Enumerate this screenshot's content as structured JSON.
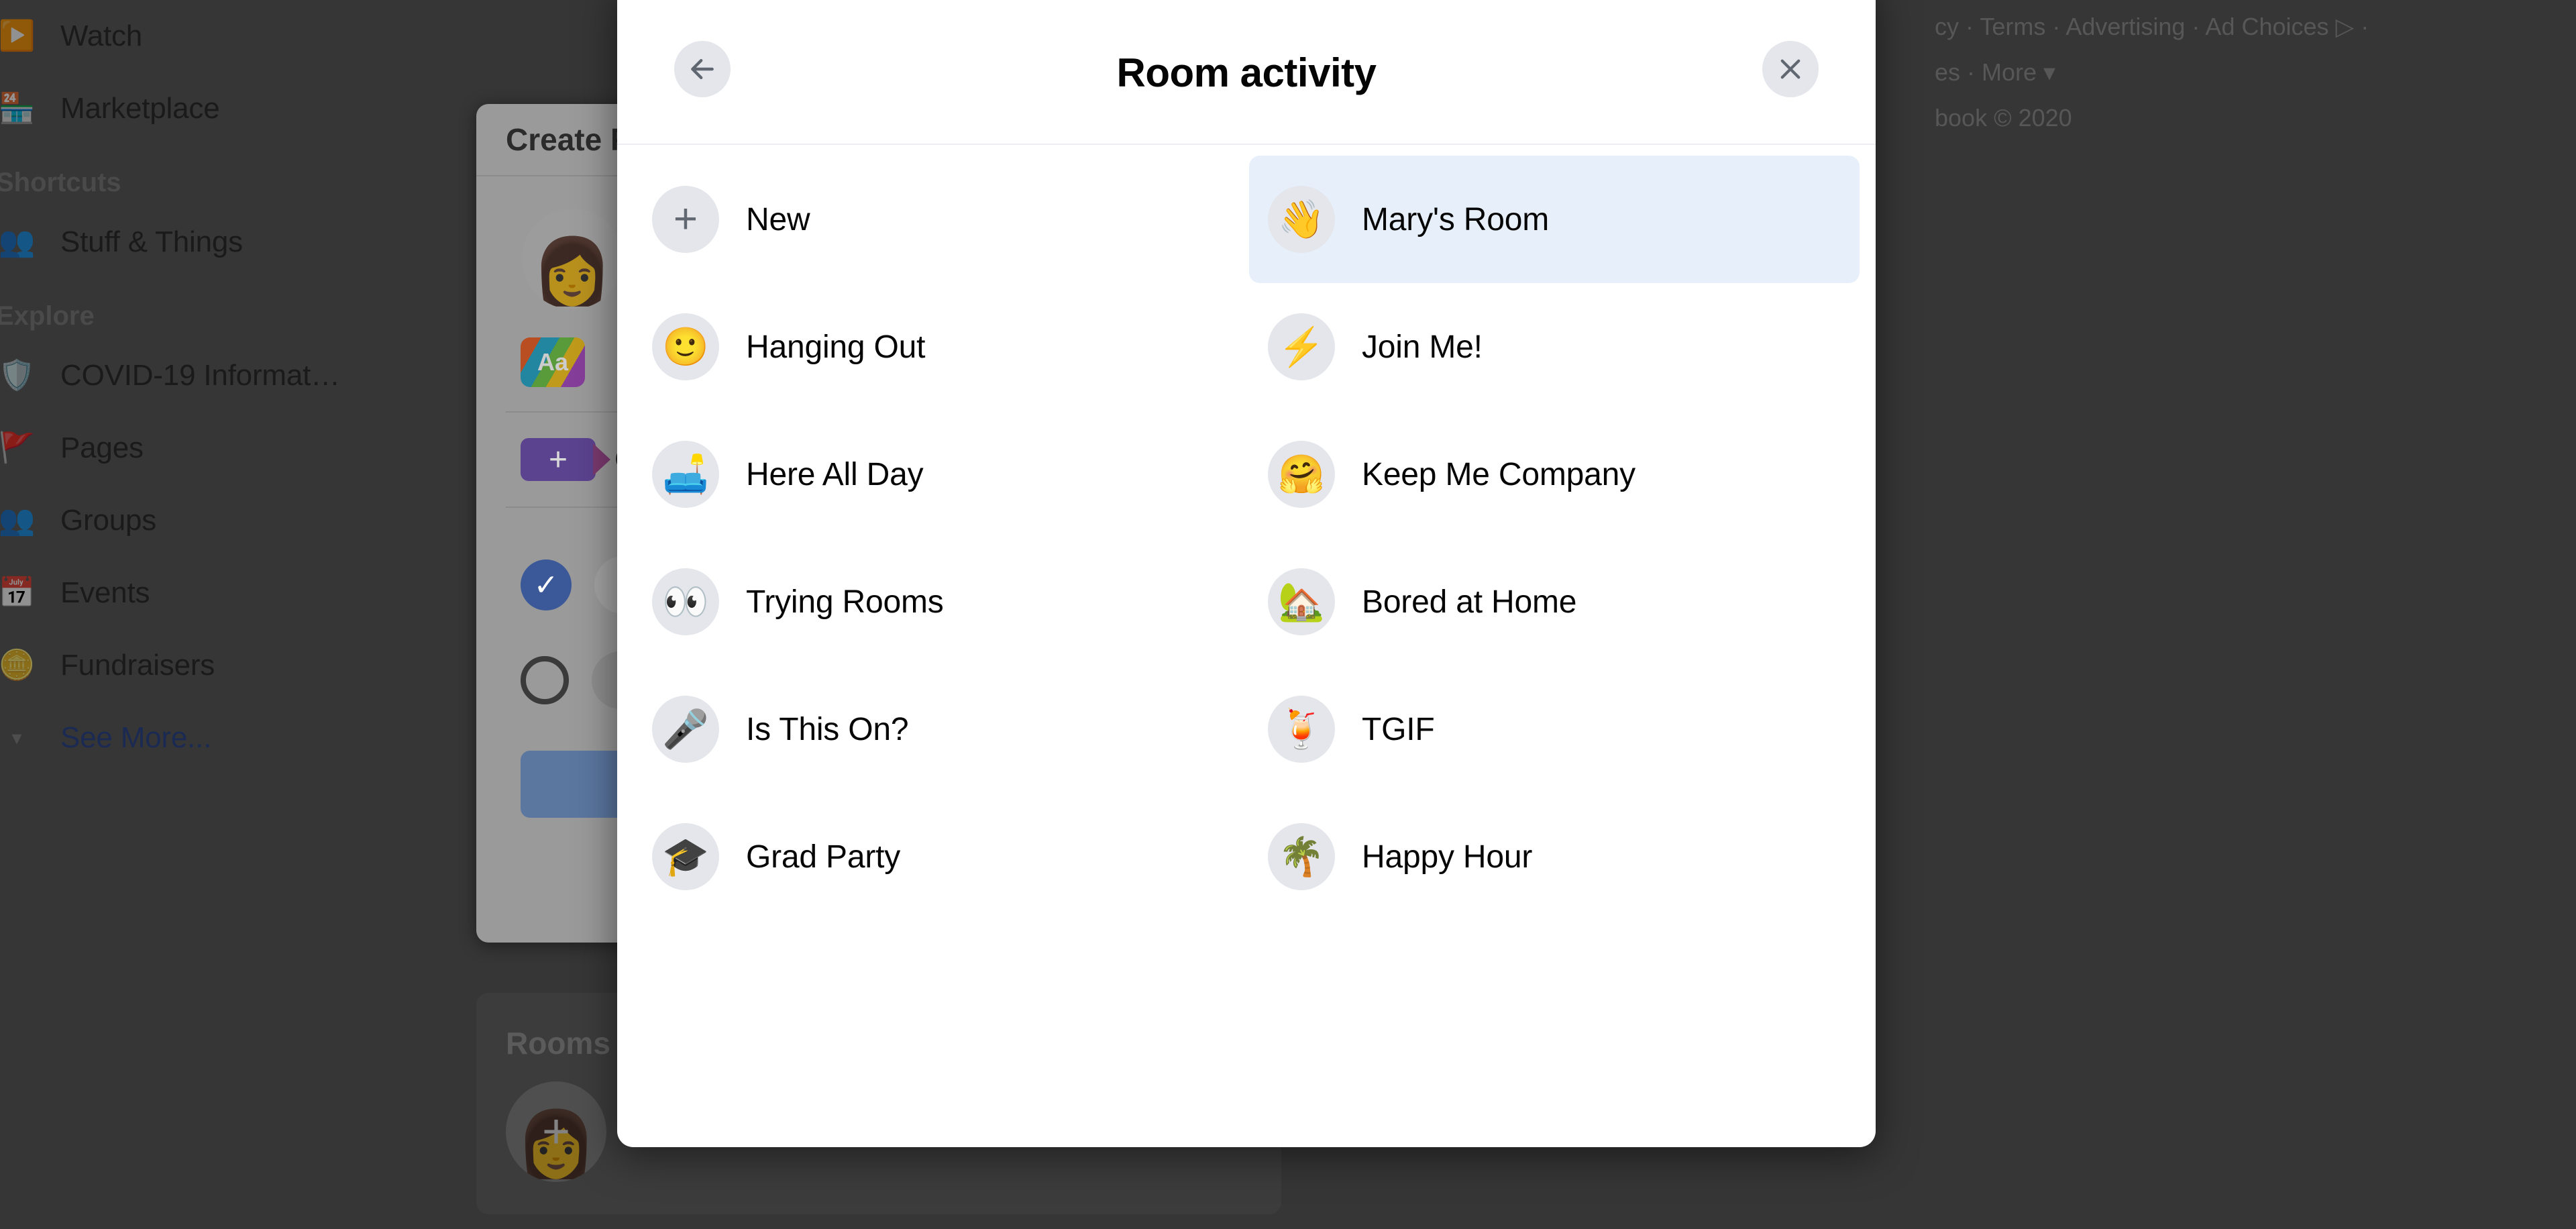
{
  "sidebar": {
    "items": [
      {
        "label": "Watch",
        "icon": "watch-icon",
        "glyph": "▶️"
      },
      {
        "label": "Marketplace",
        "icon": "marketplace-icon",
        "glyph": "🏪"
      }
    ],
    "shortcuts_heading": "Shortcuts",
    "shortcuts": [
      {
        "label": "Stuff & Things",
        "icon": "group-icon",
        "glyph": "👥"
      }
    ],
    "explore_heading": "Explore",
    "explore": [
      {
        "label": "COVID-19 Informat…",
        "icon": "covid-shield-icon",
        "glyph": "🛡️"
      },
      {
        "label": "Pages",
        "icon": "pages-flag-icon",
        "glyph": "🚩"
      },
      {
        "label": "Groups",
        "icon": "groups-icon",
        "glyph": "👥"
      },
      {
        "label": "Events",
        "icon": "events-calendar-icon",
        "glyph": "📅"
      },
      {
        "label": "Fundraisers",
        "icon": "fundraisers-icon",
        "glyph": "🪙"
      }
    ],
    "see_more": "See More..."
  },
  "create_post": {
    "title": "Create P",
    "text_bg_label": "Aa",
    "video_row_label": "C",
    "avatar": "👩"
  },
  "rooms_card": {
    "title": "Rooms",
    "avatar": "👩",
    "plus": "+"
  },
  "footer": {
    "line1": "cy · Terms · Advertising · Ad Choices ▷ ·",
    "line2": "es · More ▾",
    "line3": "book © 2020"
  },
  "modal": {
    "title": "Room activity",
    "back_icon": "arrow-left-icon",
    "close_icon": "close-icon",
    "selected_index": 1,
    "highlight_color": "#e7f0fa",
    "items": [
      {
        "label": "New",
        "icon": "plus-icon",
        "glyph": "+",
        "selected": false
      },
      {
        "label": "Mary's Room",
        "icon": "waving-hand-icon",
        "glyph": "👋",
        "selected": true
      },
      {
        "label": "Hanging Out",
        "icon": "smiley-face-icon",
        "glyph": "🙂",
        "selected": false
      },
      {
        "label": "Join Me!",
        "icon": "lightning-bolt-icon",
        "glyph": "⚡",
        "selected": false
      },
      {
        "label": "Here All Day",
        "icon": "couch-lamp-icon",
        "glyph": "🛋️",
        "selected": false
      },
      {
        "label": "Keep Me Company",
        "icon": "smiling-hands-icon",
        "glyph": "🤗",
        "selected": false
      },
      {
        "label": "Trying Rooms",
        "icon": "eyes-icon",
        "glyph": "👀",
        "selected": false
      },
      {
        "label": "Bored at Home",
        "icon": "house-icon",
        "glyph": "🏡",
        "selected": false
      },
      {
        "label": "Is This On?",
        "icon": "microphone-icon",
        "glyph": "🎤",
        "selected": false
      },
      {
        "label": "TGIF",
        "icon": "tropical-drink-icon",
        "glyph": "🍹",
        "selected": false
      },
      {
        "label": "Grad Party",
        "icon": "graduation-cap-icon",
        "glyph": "🎓",
        "selected": false
      },
      {
        "label": "Happy Hour",
        "icon": "palm-tree-icon",
        "glyph": "🌴",
        "selected": false
      }
    ]
  }
}
